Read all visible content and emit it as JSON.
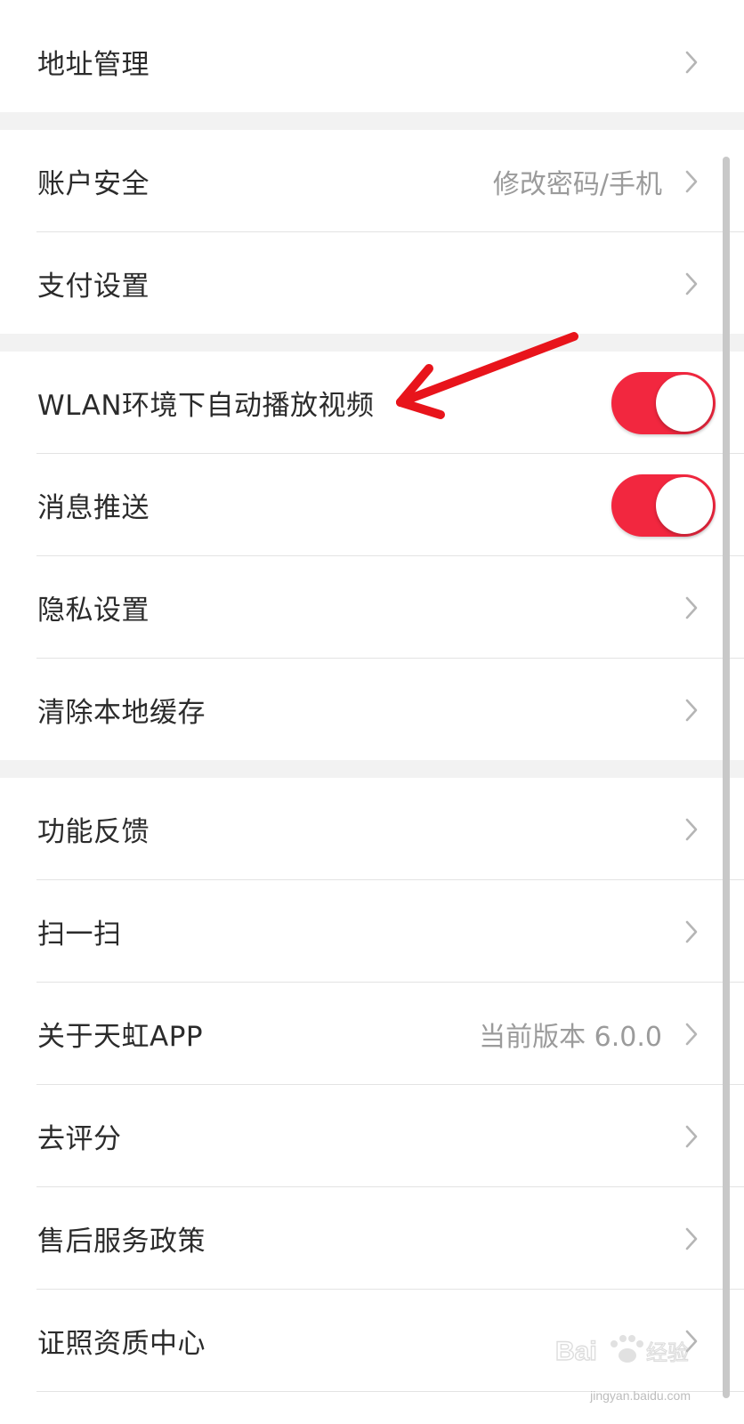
{
  "rows": [
    {
      "label": "地址管理",
      "value": ""
    },
    {
      "label": "账户安全",
      "value": "修改密码/手机"
    },
    {
      "label": "支付设置",
      "value": ""
    },
    {
      "label": "WLAN环境下自动播放视频",
      "toggle": true
    },
    {
      "label": "消息推送",
      "toggle": true
    },
    {
      "label": "隐私设置",
      "value": ""
    },
    {
      "label": "清除本地缓存",
      "value": ""
    },
    {
      "label": "功能反馈",
      "value": ""
    },
    {
      "label": "扫一扫",
      "value": ""
    },
    {
      "label": "关于天虹APP",
      "value": "当前版本 6.0.0"
    },
    {
      "label": "去评分",
      "value": ""
    },
    {
      "label": "售后服务政策",
      "value": ""
    },
    {
      "label": "证照资质中心",
      "value": ""
    }
  ],
  "watermark": {
    "logo": "Bai du 经验",
    "url": "jingyan.baidu.com"
  },
  "colors": {
    "toggle_on": "#f2273f",
    "arrow": "#e8141b",
    "text": "#2b2b2b",
    "secondary_text": "#9b9b9b",
    "divider": "#e3e3e3",
    "section_gap": "#f2f2f2"
  },
  "icons": {
    "chevron": "chevron-right-icon",
    "arrow": "red-arrow-annotation"
  }
}
